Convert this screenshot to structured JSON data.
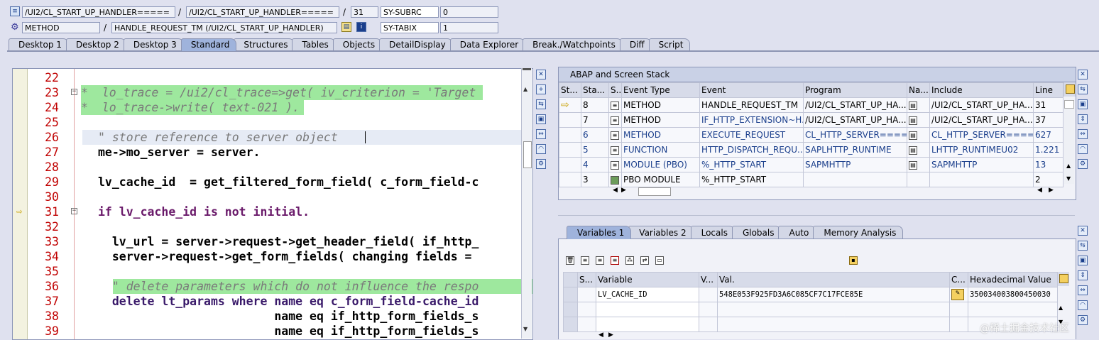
{
  "header": {
    "row1": {
      "program1": "/UI2/CL_START_UP_HANDLER=====",
      "program2": "/UI2/CL_START_UP_HANDLER=====",
      "line": "31",
      "sysfield1": "SY-SUBRC",
      "sysvalue1": "0"
    },
    "row2": {
      "event_type": "METHOD",
      "event": "HANDLE_REQUEST_TM (/UI2/CL_START_UP_HANDLER)",
      "sysfield2": "SY-TABIX",
      "sysvalue2": "1"
    },
    "sep": "/"
  },
  "tabs": [
    {
      "label": "Desktop 1"
    },
    {
      "label": "Desktop 2"
    },
    {
      "label": "Desktop 3"
    },
    {
      "label": "Standard"
    },
    {
      "label": "Structures"
    },
    {
      "label": "Tables"
    },
    {
      "label": "Objects"
    },
    {
      "label": "DetailDisplay"
    },
    {
      "label": "Data Explorer"
    },
    {
      "label": "Break./Watchpoints"
    },
    {
      "label": "Diff"
    },
    {
      "label": "Script"
    }
  ],
  "active_tab": "Standard",
  "editor": {
    "lines": [
      {
        "num": "22",
        "text": ""
      },
      {
        "num": "23",
        "text": "*  lo_trace = /ui2/cl_trace=>get( iv_criterion = 'Target"
      },
      {
        "num": "24",
        "text": "*  lo_trace->write( text-021 )."
      },
      {
        "num": "25",
        "text": ""
      },
      {
        "num": "26",
        "text": "\" store reference to server object"
      },
      {
        "num": "27",
        "text": "me->mo_server = server."
      },
      {
        "num": "28",
        "text": ""
      },
      {
        "num": "29",
        "text": "lv_cache_id  = get_filtered_form_field( c_form_field-c"
      },
      {
        "num": "30",
        "text": ""
      },
      {
        "num": "31",
        "text": "if lv_cache_id is not initial."
      },
      {
        "num": "32",
        "text": ""
      },
      {
        "num": "33",
        "text": "  lv_url = server->request->get_header_field( if_http_"
      },
      {
        "num": "34",
        "text": "  server->request->get_form_fields( changing fields = "
      },
      {
        "num": "35",
        "text": ""
      },
      {
        "num": "36",
        "text": "  \" delete parameters which do not influence the respo"
      },
      {
        "num": "37",
        "text": "  delete lt_params where name eq c_form_field-cache_id"
      },
      {
        "num": "38",
        "text": "                         name eq if_http_form_fields_s"
      },
      {
        "num": "39",
        "text": "                         name eq if_http_form_fields_s"
      }
    ]
  },
  "stack_panel": {
    "title": "ABAP and Screen Stack",
    "columns": [
      "St...",
      "Sta...",
      "S...",
      "Event Type",
      "Event",
      "Program",
      "Na...",
      "Include",
      "Line"
    ],
    "rows": [
      {
        "level": "8",
        "event_type": "METHOD",
        "event": "HANDLE_REQUEST_TM",
        "program": "/UI2/CL_START_UP_HA...",
        "include": "/UI2/CL_START_UP_HA...",
        "line": "31",
        "current": true
      },
      {
        "level": "7",
        "event_type": "METHOD",
        "event": "IF_HTTP_EXTENSION~H...",
        "program": "/UI2/CL_START_UP_HA...",
        "include": "/UI2/CL_START_UP_HA...",
        "line": "37",
        "current": false
      },
      {
        "level": "6",
        "event_type": "METHOD",
        "event": "EXECUTE_REQUEST",
        "program": "CL_HTTP_SERVER====...",
        "include": "CL_HTTP_SERVER====...",
        "line": "627",
        "current": false
      },
      {
        "level": "5",
        "event_type": "FUNCTION",
        "event": "HTTP_DISPATCH_REQU...",
        "program": "SAPLHTTP_RUNTIME",
        "include": "LHTTP_RUNTIMEU02",
        "line": "1.221",
        "current": false
      },
      {
        "level": "4",
        "event_type": "MODULE (PBO)",
        "event": "%_HTTP_START",
        "program": "SAPMHTTP",
        "include": "SAPMHTTP",
        "line": "13",
        "current": false
      },
      {
        "level": "3",
        "event_type": "PBO MODULE",
        "event": "%_HTTP_START",
        "program": "",
        "include": "",
        "line": "2",
        "current": false
      }
    ]
  },
  "var_tabs": [
    {
      "label": "Variables 1"
    },
    {
      "label": "Variables 2"
    },
    {
      "label": "Locals"
    },
    {
      "label": "Globals"
    },
    {
      "label": "Auto"
    },
    {
      "label": "Memory Analysis"
    }
  ],
  "var_panel": {
    "columns": [
      "S...",
      "Variable",
      "V...",
      "Val.",
      "C...",
      "Hexadecimal Value"
    ],
    "rows": [
      {
        "variable": "LV_CACHE_ID",
        "value": "548E053F925FD3A6C085CF7C17FCE85E",
        "hex": "350034003800450030"
      }
    ]
  },
  "watermark": "@稀土掘金技术社区"
}
